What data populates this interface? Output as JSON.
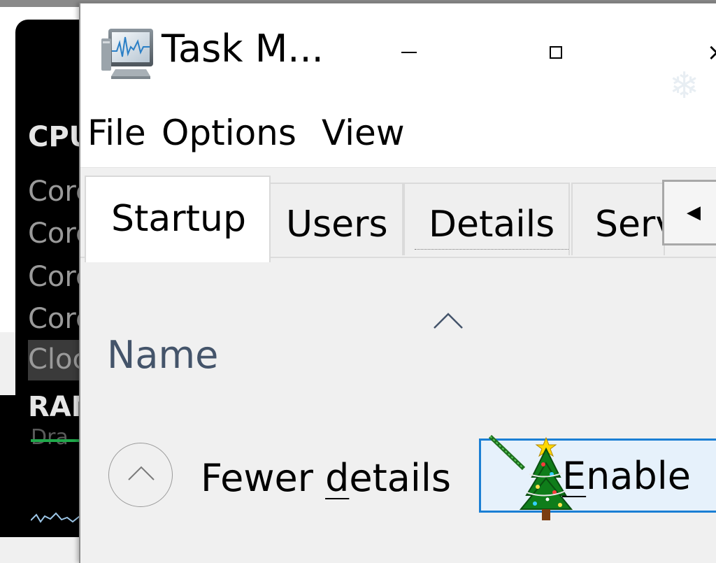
{
  "background_window": {
    "cpu_label": "CPU",
    "rows": [
      "Core",
      "Core",
      "Core",
      "Core",
      "Clock"
    ],
    "ram_label": "RAM",
    "dim_label": "Dra"
  },
  "window": {
    "title": "Task M...",
    "minimize_glyph": "–",
    "close_glyph": "×"
  },
  "menu": {
    "file": "File",
    "options": "Options",
    "view": "View"
  },
  "tabs": [
    {
      "label": "Startup",
      "selected": true
    },
    {
      "label": "Users",
      "selected": false
    },
    {
      "label": "Details",
      "selected": false
    },
    {
      "label": "Serv",
      "selected": false
    }
  ],
  "tab_scroll_glyph": "◀",
  "columns": {
    "name_header": "Name"
  },
  "footer": {
    "fewer_details_prefix": "Fewer ",
    "fewer_details_underlined": "d",
    "fewer_details_suffix": "etails",
    "enable_underlined": "E",
    "enable_suffix": "nable"
  },
  "colors": {
    "accent_border": "#1b7fd4",
    "button_fill": "#e6f1fb",
    "header_text": "#44546a"
  },
  "icons": [
    "task-manager-icon",
    "minimize-icon",
    "maximize-icon",
    "close-icon",
    "snowflake-icon",
    "scroll-left-icon",
    "sort-chevron-up-icon",
    "chevron-up-icon",
    "christmas-tree-cursor-icon"
  ]
}
